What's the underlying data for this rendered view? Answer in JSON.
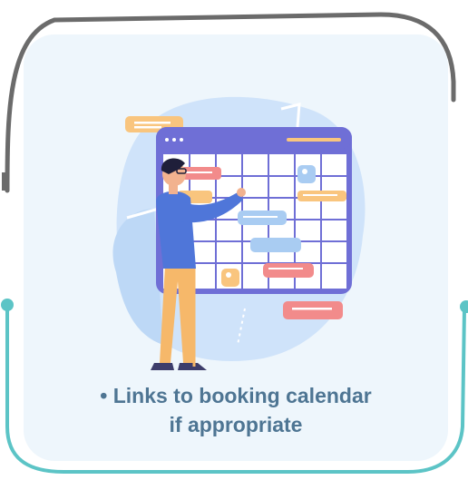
{
  "card": {
    "caption_line1": "• Links to booking calendar",
    "caption_line2": "if appropriate"
  },
  "colors": {
    "frame_gray": "#6b6b6b",
    "frame_teal": "#5cc4c6",
    "card_bg": "#eef6fc",
    "blob_blue": "#cfe3fa",
    "calendar_border": "#6f6fd6",
    "caption": "#4e7593"
  },
  "icons": {
    "illustration": "calendar-scheduling-illustration"
  }
}
